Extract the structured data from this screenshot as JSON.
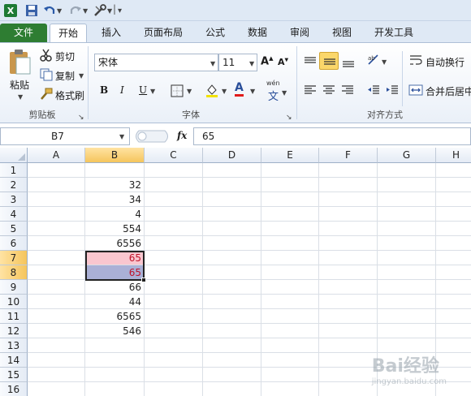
{
  "tabs": [
    "文件",
    "开始",
    "插入",
    "页面布局",
    "公式",
    "数据",
    "审阅",
    "视图",
    "开发工具"
  ],
  "clipboard": {
    "paste": "粘贴",
    "cut": "剪切",
    "copy": "复制",
    "format_painter": "格式刷",
    "group": "剪贴板"
  },
  "font": {
    "name": "宋体",
    "size": "11",
    "bold": "B",
    "italic": "I",
    "underline": "U",
    "color_letter": "A",
    "pinyin": "wén",
    "group": "字体"
  },
  "alignment": {
    "wrap": "自动换行",
    "merge": "合并后居中",
    "group": "对齐方式"
  },
  "formula_bar": {
    "name_box": "B7",
    "fx": "fx",
    "value": "65"
  },
  "columns": [
    "A",
    "B",
    "C",
    "D",
    "E",
    "F",
    "G",
    "H"
  ],
  "rows": [
    "1",
    "2",
    "3",
    "4",
    "5",
    "6",
    "7",
    "8",
    "9",
    "10",
    "11",
    "12",
    "13",
    "14",
    "15",
    "16"
  ],
  "column_b_values": [
    "",
    "32",
    "34",
    "4",
    "554",
    "6556",
    "65",
    "65",
    "66",
    "44",
    "6565",
    "546",
    "",
    "",
    "",
    ""
  ],
  "colors": {
    "file_tab": "#2e7d32",
    "b7_fill": "#f9c6cf",
    "b8_fill": "#aab0d6",
    "dup_text": "#c0142b",
    "selected_header": "#f5c55c"
  },
  "watermark": {
    "brand": "Bai经验",
    "sub": "jingyan.baidu.com"
  }
}
